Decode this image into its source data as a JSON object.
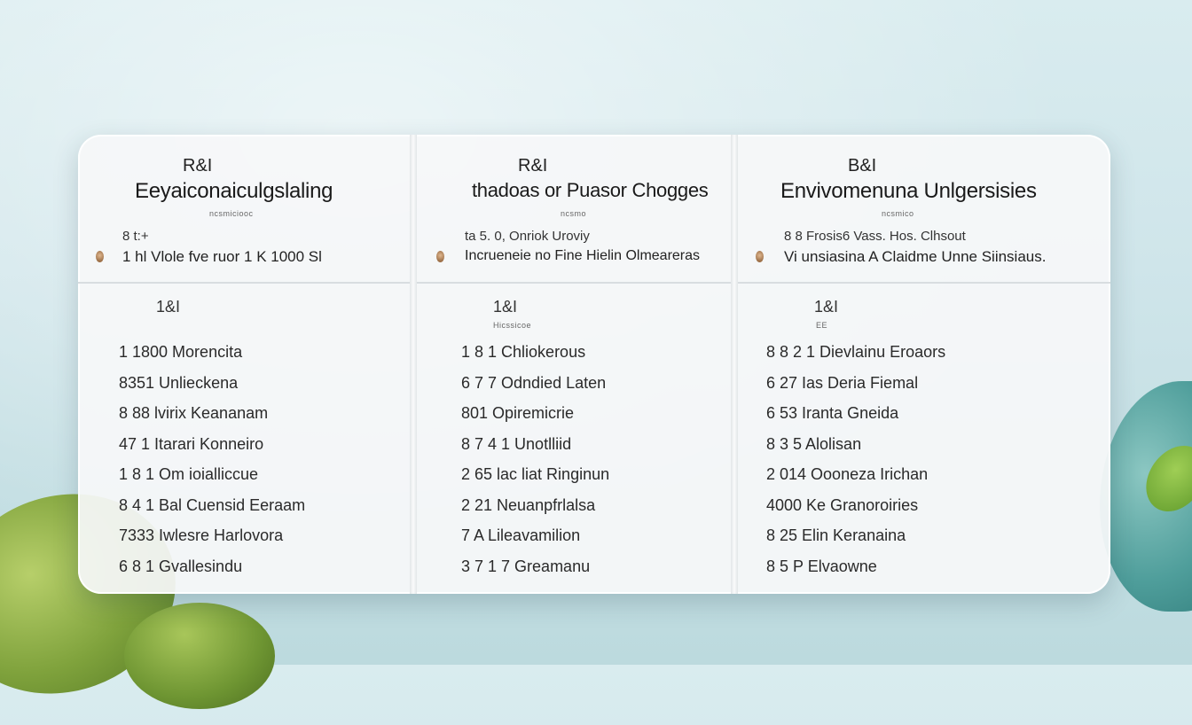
{
  "columns": [
    {
      "tag": "R&I",
      "title": "Eeyaiconaiculgslaling",
      "subtitle": "ncsmiciooc",
      "meta_top": "8 t:+",
      "meta_main": "1 hl Vlole fve ruor 1 K 1000 Sl",
      "section_label": "1&I",
      "section_sub": "",
      "rows": [
        "1 1800 Morencita",
        "8351 Unlieckena",
        "8 88 lvirix Keananam",
        "47 1 Itarari Konneiro",
        "1 8 1 Om ioialliccue",
        "8 4 1 Bal Cuensid Eeraam",
        "7333 Iwlesre Harlovora",
        "6 8 1 Gvallesindu"
      ]
    },
    {
      "tag": "R&I",
      "title": "thadoas or Puasor Chogges",
      "subtitle": "ncsmo",
      "meta_top": "ta 5. 0, Onriok Uroviy",
      "meta_main": "Incrueneie no Fine Hielin Olmeareras",
      "section_label": "1&I",
      "section_sub": "Hicssicoe",
      "rows": [
        "1 8 1 Chliokerous",
        "6 7 7 Odndied Laten",
        "801 Opiremicrie",
        "8 7 4 1 Unotlliid",
        "2 65 lac liat Ringinun",
        "2 21 Neuanpfrlalsa",
        "7 A Lileavamilion",
        "3 7 1 7 Greamanu"
      ]
    },
    {
      "tag": "B&I",
      "title": "Envivomenuna Unlgersisies",
      "subtitle": "ncsmico",
      "meta_top": "8 8 Frosis6 Vass. Hos. Clhsout",
      "meta_main": "Vi unsiasina A Claidme Unne Siinsiaus.",
      "section_label": "1&I",
      "section_sub": "EE",
      "rows": [
        "8 8 2 1 Dievlainu Eroaors",
        "6 27 Ias Deria Fiemal",
        "6 53 Iranta Gneida",
        "8 3 5 Alolisan",
        "2 014 Oooneza Irichan",
        "4000 Ke Granoroiries",
        "8 25 Elin Keranaina",
        "8 5 P Elvaowne"
      ]
    }
  ]
}
